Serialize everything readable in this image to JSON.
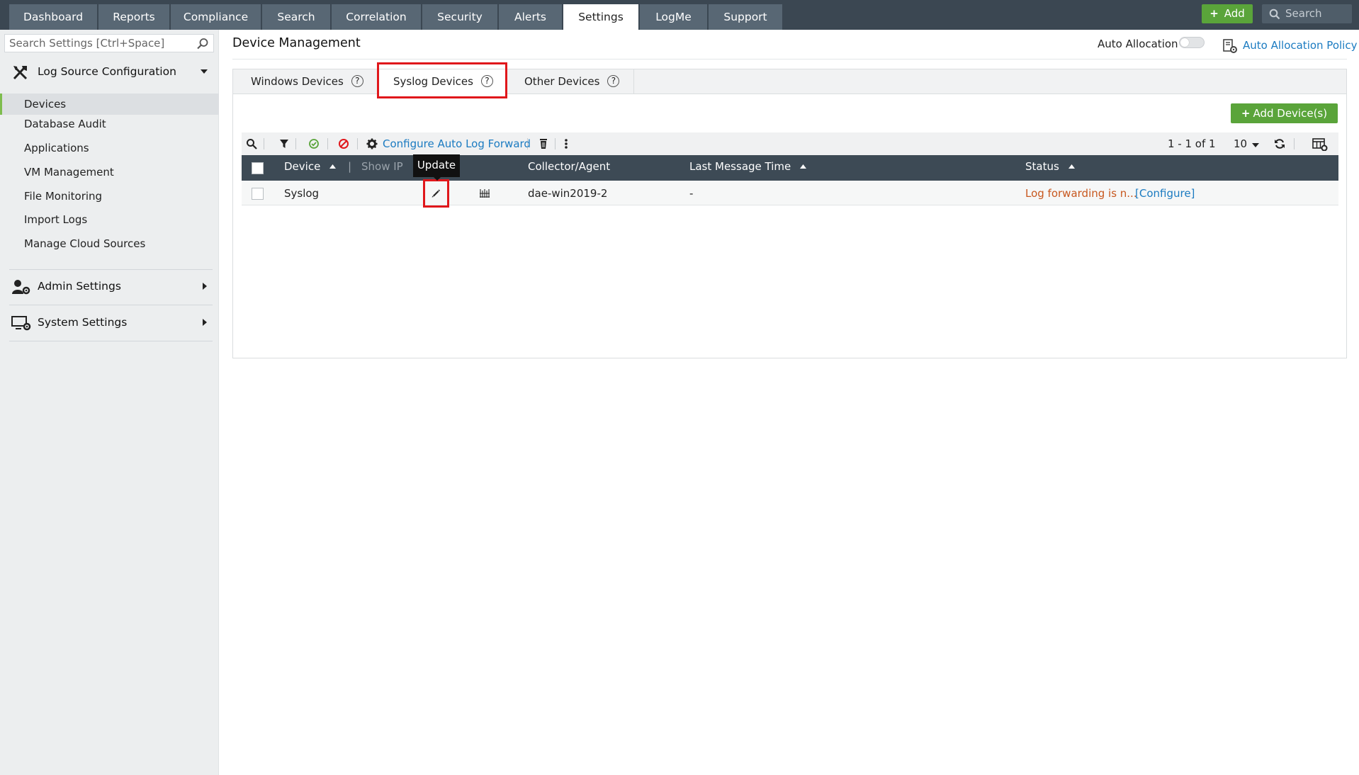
{
  "nav": {
    "tabs": [
      {
        "label": "Dashboard"
      },
      {
        "label": "Reports"
      },
      {
        "label": "Compliance"
      },
      {
        "label": "Search"
      },
      {
        "label": "Correlation"
      },
      {
        "label": "Security"
      },
      {
        "label": "Alerts"
      },
      {
        "label": "Settings",
        "active": true
      },
      {
        "label": "LogMe"
      },
      {
        "label": "Support"
      }
    ],
    "add_label": "Add",
    "search_placeholder": "Search"
  },
  "sidebar": {
    "search_placeholder": "Search Settings [Ctrl+Space]",
    "sections": {
      "log_source": "Log Source Configuration",
      "admin": "Admin Settings",
      "system": "System Settings"
    },
    "items": [
      {
        "label": "Devices",
        "active": true
      },
      {
        "label": "Database Audit"
      },
      {
        "label": "Applications"
      },
      {
        "label": "VM Management"
      },
      {
        "label": "File Monitoring"
      },
      {
        "label": "Import Logs"
      },
      {
        "label": "Manage Cloud Sources"
      }
    ]
  },
  "header": {
    "title": "Device Management",
    "auto_allocation_label": "Auto Allocation",
    "auto_allocation_on": false,
    "policy_link": "Auto Allocation Policy"
  },
  "device_tabs": [
    {
      "label": "Windows Devices",
      "help": "?"
    },
    {
      "label": "Syslog Devices",
      "help": "?",
      "active": true
    },
    {
      "label": "Other Devices",
      "help": "?"
    }
  ],
  "add_devices_label": "Add Device(s)",
  "toolbar": {
    "configure_link": "Configure Auto Log Forward",
    "pager": "1 - 1 of 1",
    "per_page": "10"
  },
  "table": {
    "headers": {
      "device": "Device",
      "show_ip": "Show IP",
      "collector": "Collector/Agent",
      "last_message": "Last Message Time",
      "status": "Status"
    },
    "rows": [
      {
        "device": "Syslog",
        "collector": "dae-win2019-2",
        "last_message": "-",
        "status": "Log forwarding is n...",
        "status_action": "[Configure]"
      }
    ]
  },
  "tooltip": "Update",
  "colors": {
    "topbar": "#3b4752",
    "accent_green": "#5aa43a",
    "link_blue": "#1b7bc1",
    "highlight_red": "#e0171b",
    "status_warn": "#c8581f"
  }
}
